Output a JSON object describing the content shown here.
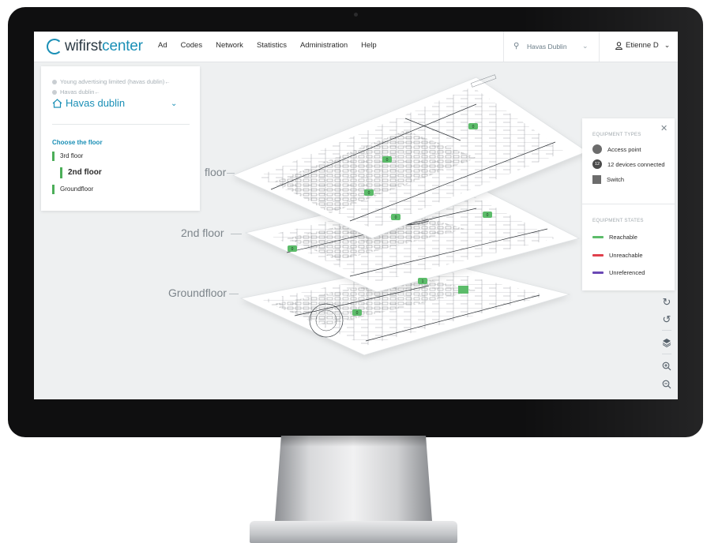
{
  "brand": {
    "name_prefix": "wifirst",
    "name_suffix": "center",
    "accent": "#1a8fb6"
  },
  "nav": {
    "items": [
      "Ad",
      "Codes",
      "Network",
      "Statistics",
      "Administration",
      "Help"
    ]
  },
  "site_selector": {
    "value": "Havas Dublin",
    "icon": "location-pin-icon"
  },
  "user": {
    "name": "Etienne D",
    "icon": "user-icon"
  },
  "left_panel": {
    "breadcrumbs": [
      "Young advertising limited (havas dublin)←",
      "Havas dublin←"
    ],
    "site_title": "Havas dublin",
    "choose_floor_label": "Choose the floor",
    "floors": [
      "3rd floor",
      "2nd floor",
      "Groundfloor"
    ],
    "selected_floor": "2nd floor"
  },
  "floor_stack": {
    "labels": [
      "floor",
      "2nd floor",
      "Groundfloor"
    ],
    "device_markers": [
      "0",
      "0",
      "0",
      "0",
      "0",
      "0",
      "1",
      "0",
      "0",
      "0",
      "0"
    ]
  },
  "legend": {
    "types_heading": "EQUIPMENT TYPES",
    "types": [
      {
        "label": "Access point",
        "icon": "access-point-circle"
      },
      {
        "label": "12 devices connected",
        "badge": "12"
      },
      {
        "label": "Switch",
        "icon": "switch-square"
      }
    ],
    "states_heading": "EQUIPMENT STATES",
    "states": [
      {
        "label": "Reachable",
        "color": "#5cbc6a"
      },
      {
        "label": "Unreachable",
        "color": "#e0404c"
      },
      {
        "label": "Unreferenced",
        "color": "#6a48b5"
      }
    ]
  },
  "tools": [
    "rotate-right-icon",
    "rotate-left-icon",
    "layers-icon",
    "zoom-in-icon",
    "zoom-out-icon"
  ],
  "colors": {
    "reachable": "#5cbc6a",
    "floor_plan_line": "#3a3f44"
  }
}
